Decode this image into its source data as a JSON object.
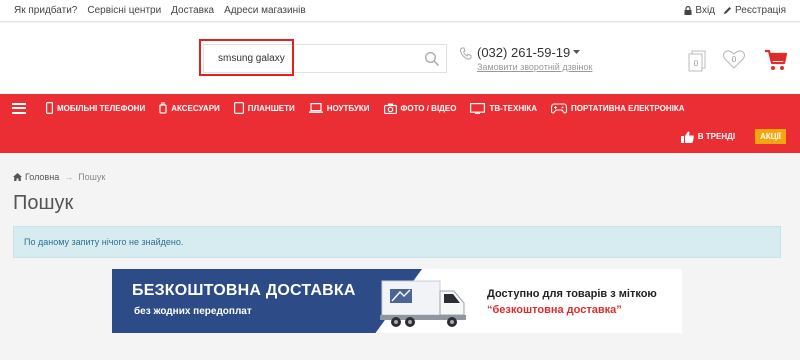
{
  "topbar": {
    "links": [
      "Як придбати?",
      "Сервісні центри",
      "Доставка",
      "Адреси магазинів"
    ],
    "login": "Вхід",
    "register": "Реєстрація"
  },
  "header": {
    "search_value": "smsung galaxy",
    "search_placeholder": "",
    "phone": "(032) 261-59-19",
    "callback": "Замовити зворотній дзвінок",
    "compare_count": "0",
    "wishlist_count": "0"
  },
  "nav": {
    "items": [
      {
        "label": "МОБІЛЬНІ ТЕЛЕФОНИ",
        "icon": "phone-icon"
      },
      {
        "label": "АКСЕСУАРИ",
        "icon": "accessories-icon"
      },
      {
        "label": "ПЛАНШЕТИ",
        "icon": "tablet-icon"
      },
      {
        "label": "НОУТБУКИ",
        "icon": "laptop-icon"
      },
      {
        "label": "ФОТО / ВІДЕО",
        "icon": "camera-icon"
      },
      {
        "label": "ТВ-ТЕХНІКА",
        "icon": "tv-icon"
      },
      {
        "label": "ПОРТАТИВНА ЕЛЕКТРОНІКА",
        "icon": "gamepad-icon"
      }
    ],
    "trends": "В ТРЕНДІ",
    "sale": "АКЦІЇ"
  },
  "breadcrumb": {
    "home": "Головна",
    "current": "Пошук"
  },
  "page": {
    "title": "Пошук",
    "empty_message": "По даному запиту нічого не знайдено."
  },
  "banner": {
    "title": "БЕЗКОШТОВНА ДОСТАВКА",
    "subtitle": "без жодних передоплат",
    "note_line1": "Доступно для товарів з міткою",
    "note_line2": "“безкоштовна доставка”"
  },
  "colors": {
    "brand_red": "#ea2e33",
    "sale_orange": "#f4a70c",
    "banner_blue": "#2d4b87",
    "alert_bg": "#d7ecf1"
  }
}
